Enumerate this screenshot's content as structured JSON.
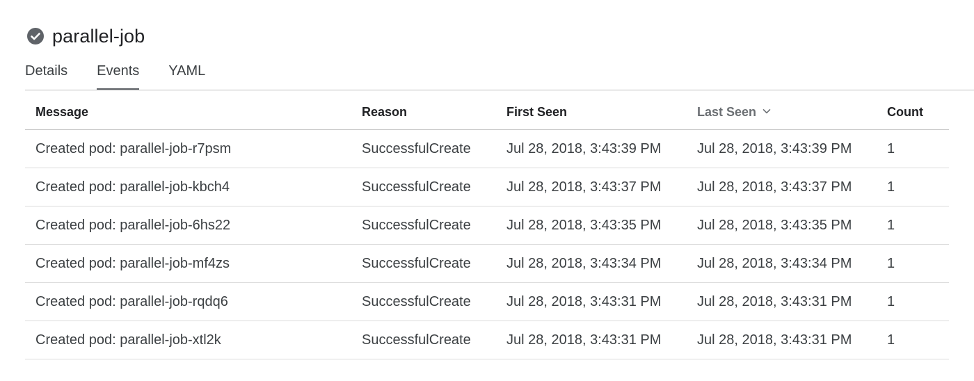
{
  "header": {
    "status_icon": "check-circle-icon",
    "status_color": "#5f6368",
    "title": "parallel-job"
  },
  "tabs": [
    {
      "label": "Details",
      "active": false
    },
    {
      "label": "Events",
      "active": true
    },
    {
      "label": "YAML",
      "active": false
    }
  ],
  "table": {
    "columns": {
      "message": "Message",
      "reason": "Reason",
      "first_seen": "First Seen",
      "last_seen": "Last Seen",
      "count": "Count"
    },
    "sort": {
      "column": "Last Seen",
      "direction": "descending",
      "icon": "chevron-down-icon"
    },
    "rows": [
      {
        "message": "Created pod: parallel-job-r7psm",
        "reason": "SuccessfulCreate",
        "first_seen": "Jul 28, 2018, 3:43:39 PM",
        "last_seen": "Jul 28, 2018, 3:43:39 PM",
        "count": "1"
      },
      {
        "message": "Created pod: parallel-job-kbch4",
        "reason": "SuccessfulCreate",
        "first_seen": "Jul 28, 2018, 3:43:37 PM",
        "last_seen": "Jul 28, 2018, 3:43:37 PM",
        "count": "1"
      },
      {
        "message": "Created pod: parallel-job-6hs22",
        "reason": "SuccessfulCreate",
        "first_seen": "Jul 28, 2018, 3:43:35 PM",
        "last_seen": "Jul 28, 2018, 3:43:35 PM",
        "count": "1"
      },
      {
        "message": "Created pod: parallel-job-mf4zs",
        "reason": "SuccessfulCreate",
        "first_seen": "Jul 28, 2018, 3:43:34 PM",
        "last_seen": "Jul 28, 2018, 3:43:34 PM",
        "count": "1"
      },
      {
        "message": "Created pod: parallel-job-rqdq6",
        "reason": "SuccessfulCreate",
        "first_seen": "Jul 28, 2018, 3:43:31 PM",
        "last_seen": "Jul 28, 2018, 3:43:31 PM",
        "count": "1"
      },
      {
        "message": "Created pod: parallel-job-xtl2k",
        "reason": "SuccessfulCreate",
        "first_seen": "Jul 28, 2018, 3:43:31 PM",
        "last_seen": "Jul 28, 2018, 3:43:31 PM",
        "count": "1"
      }
    ]
  }
}
